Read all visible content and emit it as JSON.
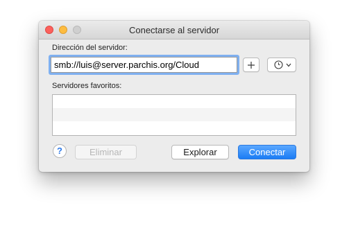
{
  "window": {
    "title": "Conectarse al servidor"
  },
  "form": {
    "address_label": "Dirección del servidor:",
    "address_value": "smb://luis@server.parchis.org/Cloud",
    "favorites_label": "Servidores favoritos:",
    "favorites": []
  },
  "buttons": {
    "help": "?",
    "delete": "Eliminar",
    "browse": "Explorar",
    "connect": "Conectar"
  },
  "icons": {
    "add": "plus-icon",
    "recent": "clock-icon",
    "dropdown": "chevron-down-icon"
  },
  "colors": {
    "accent": "#1b7cf4",
    "focus_ring": "#7fb0f0",
    "close": "#fc605c",
    "minimize": "#fdbc40"
  }
}
